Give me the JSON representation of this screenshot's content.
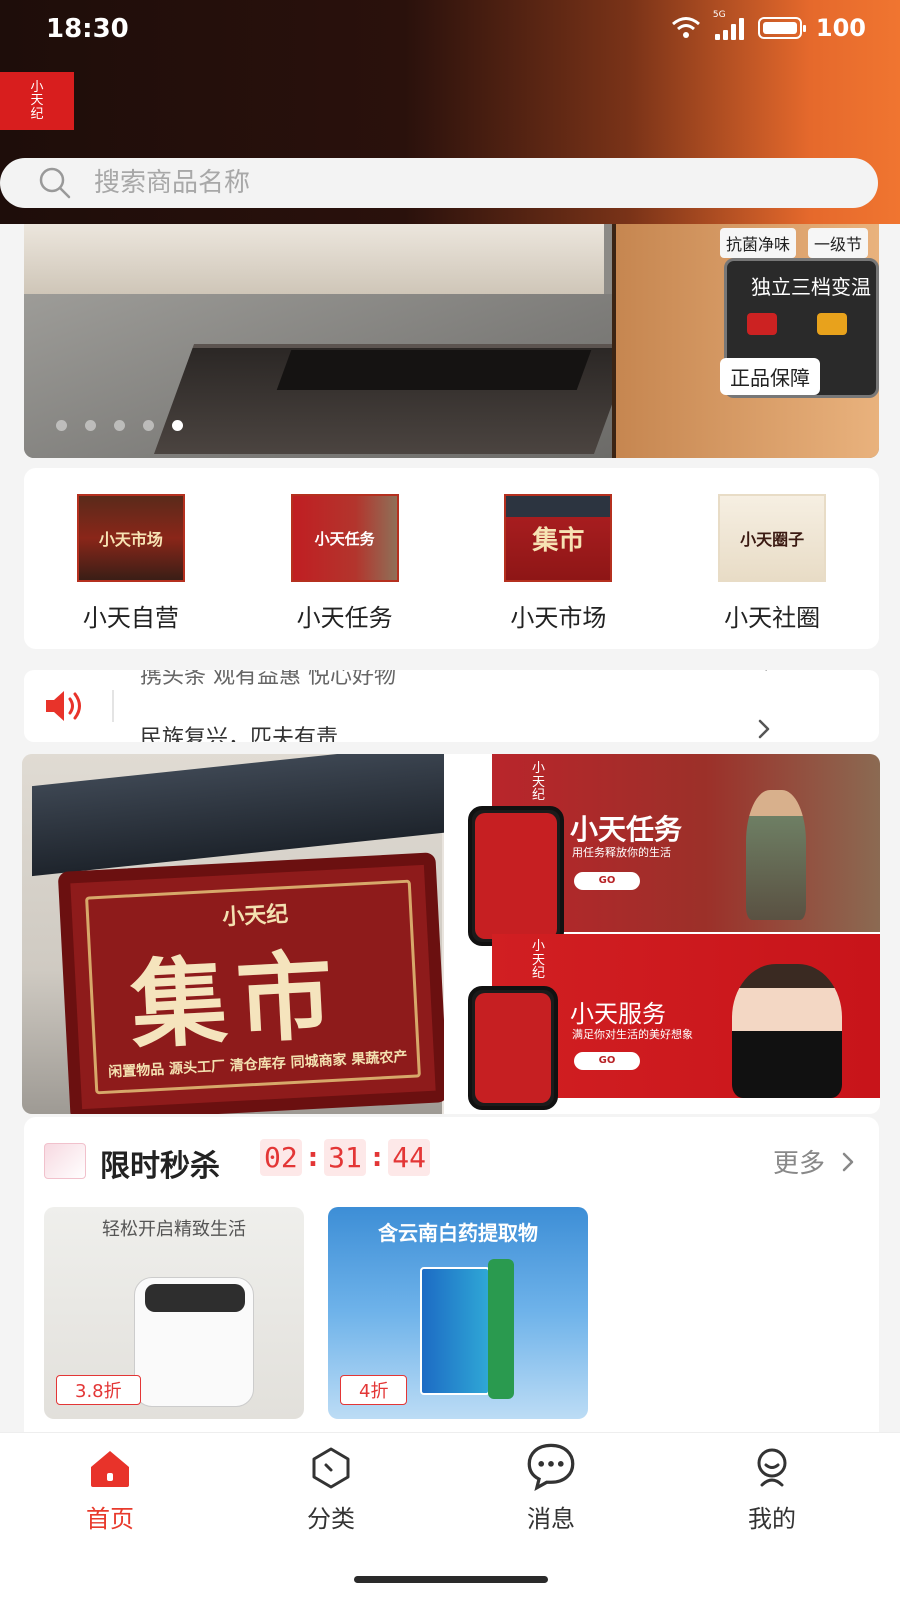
{
  "status_bar": {
    "time": "18:30",
    "network": "5G",
    "battery": "100"
  },
  "header": {
    "logo_text": "小\n天\n纪"
  },
  "search": {
    "placeholder": "搜索商品名称"
  },
  "banner": {
    "chip_1": "抗菌净味",
    "chip_2": "一级节",
    "panel_title": "独立三档变温",
    "badge": "正品保障",
    "dots": 5,
    "active_dot": 4
  },
  "categories": [
    {
      "label": "小天自营",
      "image_text": "小天市场",
      "icon": "shop-sign-image"
    },
    {
      "label": "小天任务",
      "image_text": "小天任务",
      "icon": "task-poster-image"
    },
    {
      "label": "小天市场",
      "image_text": "集市",
      "icon": "market-sign-image"
    },
    {
      "label": "小天社圈",
      "image_text": "小天圈子",
      "icon": "circle-painting-image"
    }
  ],
  "notice": {
    "text": "民族复兴，匹夫有责",
    "previous_text": "携头条 观有益惠 悦心好物"
  },
  "promo": {
    "sign_small": "小天纪",
    "sign_big": "集市",
    "sign_foot": "闲置物品 源头工厂 清仓库存 同城商家 果蔬农产",
    "card1_title": "小天任务",
    "card1_sub": "用任务释放你的生活",
    "card2_title": "小天服务",
    "card2_sub": "满足你对生活的美好想象",
    "go": "GO",
    "logo_text": "小\n天\n纪"
  },
  "flash_sale": {
    "title": "限时秒杀",
    "hours": "02",
    "minutes": "31",
    "seconds": "44",
    "more": "更多",
    "products": [
      {
        "discount": "3.8折",
        "tag": "轻松开启精致生活"
      },
      {
        "discount": "4折",
        "tag": "含云南白药提取物"
      }
    ]
  },
  "tabbar": [
    {
      "label": "首页",
      "icon": "home-icon",
      "active": true
    },
    {
      "label": "分类",
      "icon": "category-icon",
      "active": false
    },
    {
      "label": "消息",
      "icon": "message-icon",
      "active": false
    },
    {
      "label": "我的",
      "icon": "profile-icon",
      "active": false
    }
  ],
  "colors": {
    "accent": "#e83a2c",
    "brand_red": "#d81e1e",
    "header_dark": "#1e0d0a",
    "header_orange": "#f07530"
  }
}
